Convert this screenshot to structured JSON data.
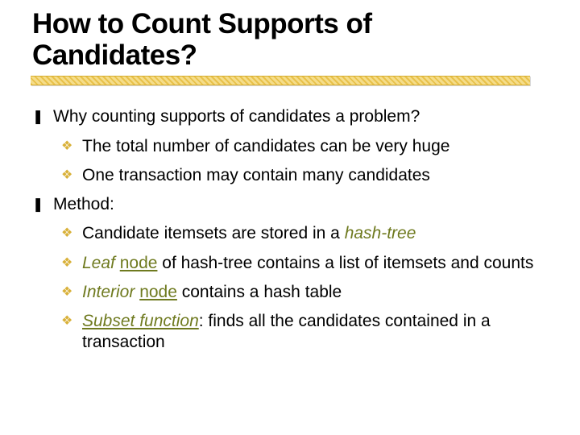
{
  "title_line1": "How to Count Supports of",
  "title_line2": "Candidates?",
  "b1": "Why counting supports of candidates a problem?",
  "b1a": "The total number of candidates can be very huge",
  "b1b": " One transaction may contain many candidates",
  "b2": "Method:",
  "b2a_pre": "Candidate itemsets are stored in a ",
  "b2a_em": "hash-tree",
  "b2b_em": "Leaf",
  "b2b_mid": " ",
  "b2b_u": "node",
  "b2b_post": " of hash-tree contains a list of itemsets and counts",
  "b2c_em": "Interior",
  "b2c_mid": " ",
  "b2c_u": "node",
  "b2c_post": " contains a hash table",
  "b2d_em": "Subset function",
  "b2d_post": ": finds all the candidates contained in a transaction"
}
